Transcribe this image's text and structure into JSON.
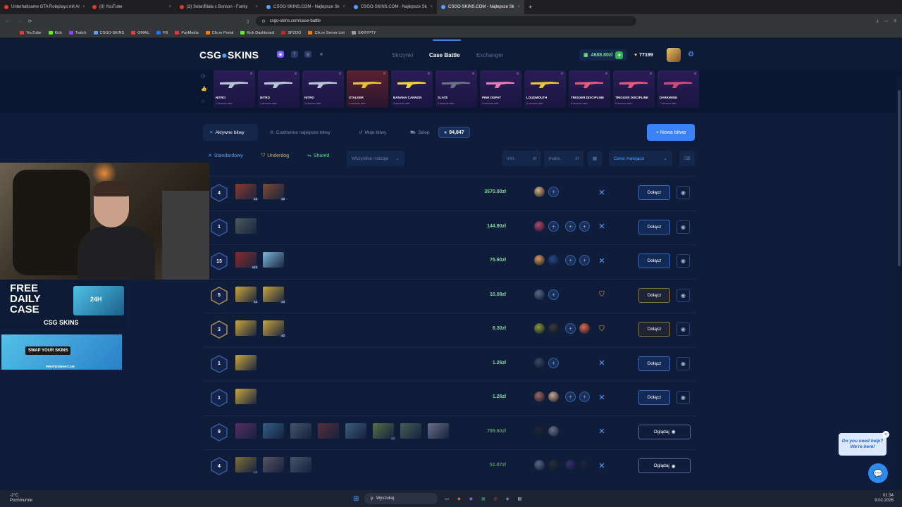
{
  "browser": {
    "tabs": [
      {
        "label": "Unterhaltsame GTA Roleplays mit Ar",
        "color": "#e53935"
      },
      {
        "label": "(3) YouTube",
        "color": "#e53935"
      },
      {
        "label": "(3) Solar/Biała x Bonson - Funky",
        "color": "#e53935"
      },
      {
        "label": "CSGO-SKINS.COM - Najlepsze Sk",
        "color": "#5aa0ff"
      },
      {
        "label": "CSGO-SKINS.COM - Najlepsze Sk",
        "color": "#5aa0ff"
      },
      {
        "label": "CSGO-SKINS.COM - Najlepsze Sk",
        "color": "#5aa0ff"
      }
    ],
    "url": "csgo-skins.com/case-battle",
    "bookmarks": [
      {
        "label": "YouTube",
        "color": "#e53935"
      },
      {
        "label": "Kick",
        "color": "#53fc18"
      },
      {
        "label": "Twitch",
        "color": "#9146ff"
      },
      {
        "label": "CSGO-SKINS",
        "color": "#5aa0ff"
      },
      {
        "label": "GMAIL",
        "color": "#ea4335"
      },
      {
        "label": "FB",
        "color": "#1877f2"
      },
      {
        "label": "PayMedia",
        "color": "#e53935"
      },
      {
        "label": "Cfx.re Portal",
        "color": "#f57c00"
      },
      {
        "label": "Kick Dashboard",
        "color": "#53fc18"
      },
      {
        "label": "SPZOO",
        "color": "#c62828"
      },
      {
        "label": "Cfx.re Server List",
        "color": "#f57c00"
      },
      {
        "label": "SKRYPTY",
        "color": "#9e9e9e"
      }
    ]
  },
  "site": {
    "logo_part1": "CSG",
    "logo_part2": "SKINS",
    "nav": [
      "Skrzynki",
      "Case Battle",
      "Exchanger"
    ],
    "balance": "4688.80zł",
    "coins": "77199",
    "live_drops": [
      {
        "name": "NITRO",
        "sub": "2 seconds later",
        "color": "#b8c4d4",
        "red": false
      },
      {
        "name": "NITRO",
        "sub": "3 seconds later",
        "color": "#b8c4d4",
        "red": false
      },
      {
        "name": "NITRO",
        "sub": "3 seconds later",
        "color": "#b8c4d4",
        "red": false
      },
      {
        "name": "STALKER",
        "sub": "4 seconds later",
        "color": "#e8c13a",
        "red": true
      },
      {
        "name": "BANANA CANNON",
        "sub": "4 seconds later",
        "color": "#f3d43a",
        "red": false
      },
      {
        "name": "SLATE",
        "sub": "5 seconds later",
        "color": "#6b7280",
        "red": false
      },
      {
        "name": "PINK DDPAT",
        "sub": "5 seconds later",
        "color": "#e67ab8",
        "red": false
      },
      {
        "name": "LOUDMOUTH",
        "sub": "6 seconds later",
        "color": "#e8c13a",
        "red": false
      },
      {
        "name": "TRIGGER DISCIPLINE",
        "sub": "6 seconds later",
        "color": "#e05a7a",
        "red": false
      },
      {
        "name": "TRIGGER DISCIPLINE",
        "sub": "6 seconds later",
        "color": "#e05a7a",
        "red": false
      },
      {
        "name": "DARKWING",
        "sub": "7 seconds later",
        "color": "#d04a7a",
        "red": false
      }
    ],
    "tabs": {
      "active": "Aktywne bitwy",
      "daily": "Codzienne najlepsze bitwy",
      "mine": "Moje bitwy",
      "shop": "Sklep",
      "count": "94,847",
      "new_battle": "+ Nowa bitwa"
    },
    "filters": {
      "standard": "Standardowy",
      "underdog": "Underdog",
      "shared": "Shared",
      "all_types": "Wszystkie rodzaje",
      "min": "min.",
      "max": "maks.",
      "currency": "zł",
      "sort": "Cena malejąco"
    },
    "battles": [
      {
        "rounds": "4",
        "price": "3570.00zł",
        "cases": [
          {
            "c": "#8a3a2a",
            "m": "x2"
          },
          {
            "c": "#7a4a30",
            "m": "x2"
          }
        ],
        "players": [
          {
            "c": "#d8b080"
          },
          {
            "empty": true
          }
        ],
        "mode": "standard",
        "action": "Dołącz",
        "dim": false,
        "gold": false
      },
      {
        "rounds": "1",
        "price": "144.90zł",
        "cases": [
          {
            "c": "#4a5a5a",
            "m": ""
          }
        ],
        "players": [
          {
            "c": "#b04a6a"
          },
          {
            "empty": true
          },
          {
            "empty": true
          },
          {
            "empty": true
          }
        ],
        "mode": "standard",
        "action": "Dołącz",
        "dim": false,
        "gold": false
      },
      {
        "rounds": "13",
        "price": "75.60zł",
        "cases": [
          {
            "c": "#8a2a2a",
            "m": "x12"
          },
          {
            "c": "#7ab8d8",
            "m": ""
          }
        ],
        "players": [
          {
            "c": "#d89a60"
          },
          {
            "c": "#2a4a8a"
          },
          {
            "empty": true
          },
          {
            "empty": true
          }
        ],
        "mode": "standard",
        "action": "Dołącz",
        "dim": false,
        "gold": false
      },
      {
        "rounds": "5",
        "price": "10.08zł",
        "cases": [
          {
            "c": "#c9a63a",
            "m": "x2"
          },
          {
            "c": "#c9a63a",
            "m": "x3"
          }
        ],
        "players": [
          {
            "c": "#5a6a8a"
          },
          {
            "empty": true
          }
        ],
        "mode": "underdog",
        "action": "Dołącz",
        "dim": false,
        "gold": true
      },
      {
        "rounds": "3",
        "price": "6.30zł",
        "cases": [
          {
            "c": "#c9a63a",
            "m": ""
          },
          {
            "c": "#c9a63a",
            "m": "x2"
          }
        ],
        "players": [
          {
            "c": "#8a9a3a"
          },
          {
            "c": "#3a3a3a"
          },
          {
            "empty": true
          },
          {
            "c": "#e06a4a"
          }
        ],
        "mode": "underdog",
        "action": "Dołącz",
        "dim": false,
        "gold": true
      },
      {
        "rounds": "1",
        "price": "1.26zł",
        "cases": [
          {
            "c": "#c9a63a",
            "m": ""
          }
        ],
        "players": [
          {
            "c": "#3a4a6a"
          },
          {
            "empty": true
          }
        ],
        "mode": "standard",
        "action": "Dołącz",
        "dim": false,
        "gold": false
      },
      {
        "rounds": "1",
        "price": "1.26zł",
        "cases": [
          {
            "c": "#c9a63a",
            "m": ""
          }
        ],
        "players": [
          {
            "c": "#9a6a6a"
          },
          {
            "c": "#caa88a"
          },
          {
            "empty": true
          },
          {
            "empty": true
          }
        ],
        "mode": "standard",
        "action": "Dołącz",
        "dim": false,
        "gold": false
      },
      {
        "rounds": "9",
        "price": "789.60zł",
        "cases": [
          {
            "c": "#8a3a7a",
            "m": ""
          },
          {
            "c": "#4a8ab8",
            "m": ""
          },
          {
            "c": "#6a7a8a",
            "m": ""
          },
          {
            "c": "#8a3a3a",
            "m": ""
          },
          {
            "c": "#5a8aa8",
            "m": ""
          },
          {
            "c": "#8aa84a",
            "m": "x2"
          },
          {
            "c": "#6a8a6a",
            "m": ""
          },
          {
            "c": "#a8a8b8",
            "m": ""
          }
        ],
        "players": [
          {
            "c": "#2a2a3a"
          },
          {
            "c": "#a8a8b8"
          }
        ],
        "mode": "standard",
        "action": "Oglądaj",
        "dim": true,
        "gold": false
      },
      {
        "rounds": "4",
        "price": "51.87zł",
        "cases": [
          {
            "c": "#c9a63a",
            "m": "x2"
          },
          {
            "c": "#8a7a7a",
            "m": ""
          },
          {
            "c": "#6a7a8a",
            "m": ""
          }
        ],
        "players": [
          {
            "c": "#8a9ab8"
          },
          {
            "c": "#3a3a3a"
          },
          {
            "c": "#4a3a8a"
          },
          {
            "c": "#2a2a3a"
          }
        ],
        "mode": "standard",
        "action": "Oglądaj",
        "dim": true,
        "gold": false
      }
    ]
  },
  "overlay": {
    "free_daily_case": "FREE DAILY CASE",
    "brand": "CSG SKINS",
    "swap": "SWAP YOUR SKINS",
    "pirateswap": "PIRATESWAP.COM",
    "box_label": "24H"
  },
  "chat": {
    "help_text": "Do you need help? We're here!"
  },
  "taskbar": {
    "weather": "-2°C",
    "weather_desc": "Pochmurnie",
    "search": "Wyszukaj",
    "time": "01:34",
    "date": "9.02.2026"
  },
  "colors": {
    "accent": "#3b82f6",
    "price_green": "#6ee38a",
    "underdog_gold": "#e0b24a"
  }
}
